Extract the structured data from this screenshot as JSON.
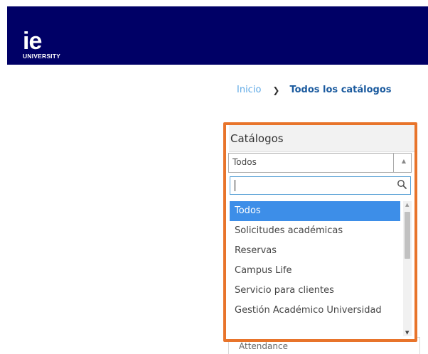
{
  "header": {
    "logo_mark": "ie",
    "logo_sub": "UNIVERSITY",
    "brand_color": "#000066"
  },
  "breadcrumb": {
    "home": "Inicio",
    "current": "Todos los catálogos"
  },
  "catalogs": {
    "title": "Catálogos",
    "selected_value": "Todos",
    "search_value": "",
    "options": [
      "Todos",
      "Solicitudes académicas",
      "Reservas",
      "Campus Life",
      "Servicio para clientes",
      "Gestión Académico Universidad"
    ],
    "behind_option": "Attendance",
    "highlight_color": "#e8742b",
    "selected_color": "#3d8ee8"
  }
}
